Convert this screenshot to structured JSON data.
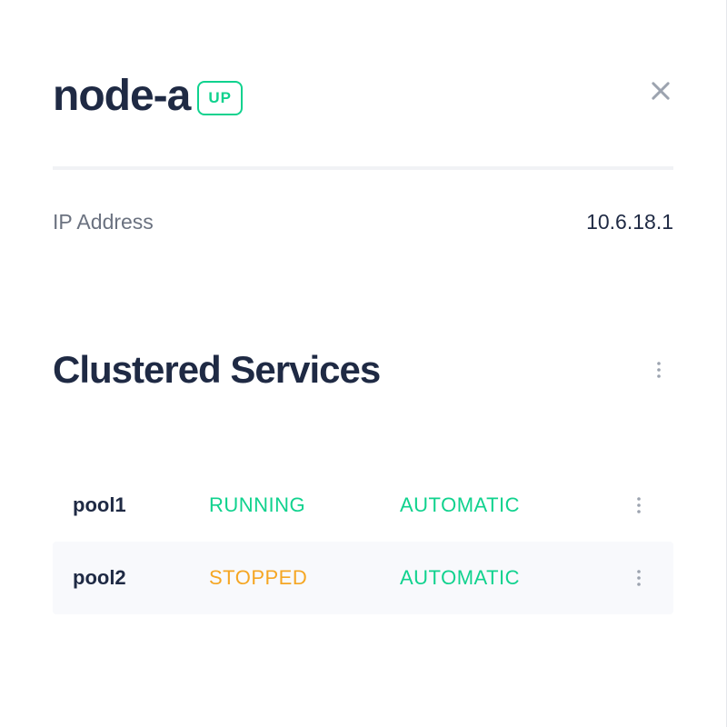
{
  "header": {
    "title": "node-a",
    "status_badge": "UP"
  },
  "info": {
    "ip_label": "IP Address",
    "ip_value": "10.6.18.1"
  },
  "services": {
    "title": "Clustered Services",
    "rows": [
      {
        "name": "pool1",
        "status": "RUNNING",
        "mode": "AUTOMATIC"
      },
      {
        "name": "pool2",
        "status": "STOPPED",
        "mode": "AUTOMATIC"
      }
    ]
  },
  "colors": {
    "running": "#10d28e",
    "stopped": "#f5a623",
    "text_primary": "#1f2a44",
    "text_secondary": "#6b7280"
  }
}
